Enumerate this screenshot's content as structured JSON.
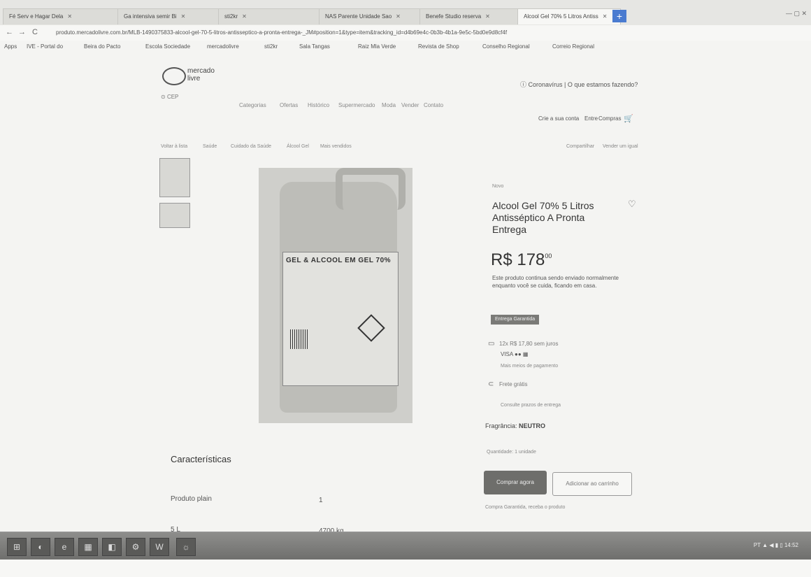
{
  "browser": {
    "tabs": [
      {
        "label": "Fé Serv e Hagar Dela",
        "active": false
      },
      {
        "label": "Ga intensiva semir Bi",
        "active": false
      },
      {
        "label": "sti2kr",
        "active": false
      },
      {
        "label": "NAS Parente Unidade Sao",
        "active": false
      },
      {
        "label": "Benefe Studio reserva",
        "active": false
      },
      {
        "label": "Alcool Gel 70% 5 Litros Antiss",
        "active": true
      }
    ],
    "new_tab_label": "+",
    "window_controls": "— ▢ ✕",
    "back_icon": "←",
    "forward_icon": "→",
    "reload_icon": "C",
    "url": "produto.mercadolivre.com.br/MLB-1490375833-alcool-gel-70-5-litros-antisseptico-a-pronta-entrega-_JM#position=1&type=item&tracking_id=d4b69e4c-0b3b-4b1a-9e5c-5bd0e9d8cf4f",
    "bookmarks": [
      "Apps",
      "IVE - Portal do",
      "Beira do Pacto",
      "Escola Sociedade",
      "mercadolivre",
      "sti2kr",
      "Sala Tangas",
      "Raiz Mla Verde",
      "Revista de Shop",
      "Conselho Regional",
      "Correio Regional"
    ]
  },
  "header": {
    "logo_line1": "mercado",
    "logo_line2": "livre",
    "cep": "CEP",
    "search_prompt": "Coronavírus | O que estamos fazendo?",
    "nav_links": [
      "Categorias",
      "Ofertas",
      "Histórico",
      "Supermercado",
      "Moda",
      "Vender",
      "Contato"
    ],
    "account_links": [
      "Crie a sua conta",
      "Entre",
      "Compras"
    ],
    "cart_icon": "🛒"
  },
  "breadcrumb": {
    "items": [
      "Voltar à lista",
      "Saúde",
      "Cuidado da Saúde",
      "Álcool Gel",
      "Mais vendidos"
    ],
    "right_items": [
      "Compartilhar",
      "Vender um igual"
    ]
  },
  "product": {
    "condition": "Novo",
    "title": "Alcool Gel 70% 5 Litros Antisséptico A Pronta Entrega",
    "price_currency": "R$",
    "price_integer": "178",
    "price_cents": "00",
    "description": "Este produto continua sendo enviado normalmente enquanto você se cuida, ficando em casa.",
    "badge": "Entrega Garantida",
    "payment_text": "12x R$ 17,80 sem juros",
    "cards": "VISA ●● ▦",
    "more_payment": "Mais meios de pagamento",
    "shipping_text": "Frete grátis",
    "shipping_sub": "Consulte prazos de entrega",
    "fragrance_label": "Fragrância:",
    "fragrance_value": "NEUTRO",
    "quantity_label": "Quantidade: 1 unidade",
    "buy_button": "Comprar agora",
    "cart_button": "Adicionar ao carrinho",
    "guarantee": "Compra Garantida, receba o produto",
    "image_label": "GEL & ALCOOL EM GEL 70%"
  },
  "characteristics": {
    "title": "Características",
    "rows": [
      {
        "label": "Produto plain",
        "value": "1"
      },
      {
        "label": "5 L",
        "value": "4700 kg"
      }
    ]
  },
  "taskbar": {
    "icons": [
      "⊞",
      "◐",
      "e",
      "▦",
      "◧",
      "⚙",
      "W",
      "☼"
    ],
    "tray": "PT ▲ ◀ ▮ ▯ 14:52"
  }
}
